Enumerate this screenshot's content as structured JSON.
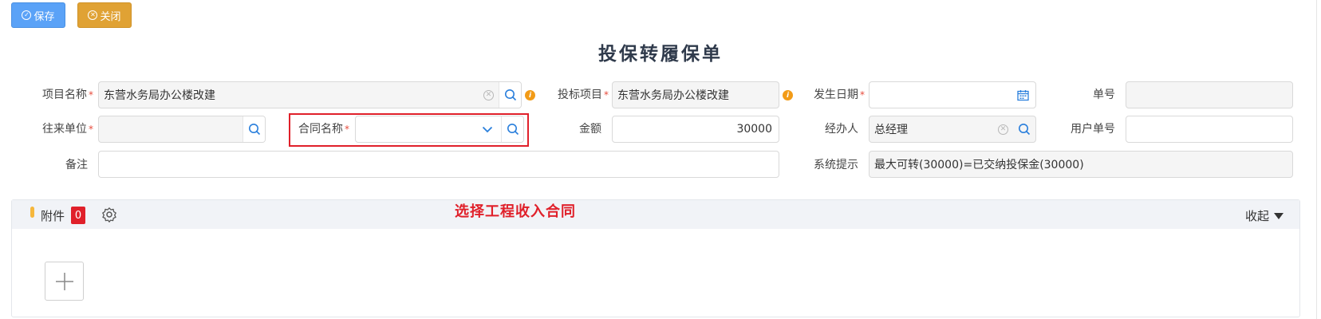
{
  "toolbar": {
    "save_label": "保存",
    "close_label": "关闭"
  },
  "form": {
    "title": "投保转履保单",
    "project_name": {
      "label": "项目名称",
      "value": "东营水务局办公楼改建"
    },
    "bid_project": {
      "label": "投标项目",
      "value": "东营水务局办公楼改建"
    },
    "occur_date": {
      "label": "发生日期",
      "value": ""
    },
    "doc_no": {
      "label": "单号",
      "value": ""
    },
    "partner": {
      "label": "往来单位",
      "value": ""
    },
    "contract_name": {
      "label": "合同名称",
      "value": ""
    },
    "amount": {
      "label": "金额",
      "value": "30000"
    },
    "handler": {
      "label": "经办人",
      "value": "总经理"
    },
    "user_doc_no": {
      "label": "用户单号",
      "value": ""
    },
    "remark": {
      "label": "备注",
      "value": ""
    },
    "system_tip": {
      "label": "系统提示",
      "value": "最大可转(30000)=已交纳投保金(30000)"
    }
  },
  "attachments": {
    "label": "附件",
    "count": "0",
    "collapse_label": "收起"
  },
  "annotation": "选择工程收入合同",
  "colors": {
    "primary": "#5aa2f7",
    "warning": "#e0a234",
    "highlight": "#e0202a"
  }
}
